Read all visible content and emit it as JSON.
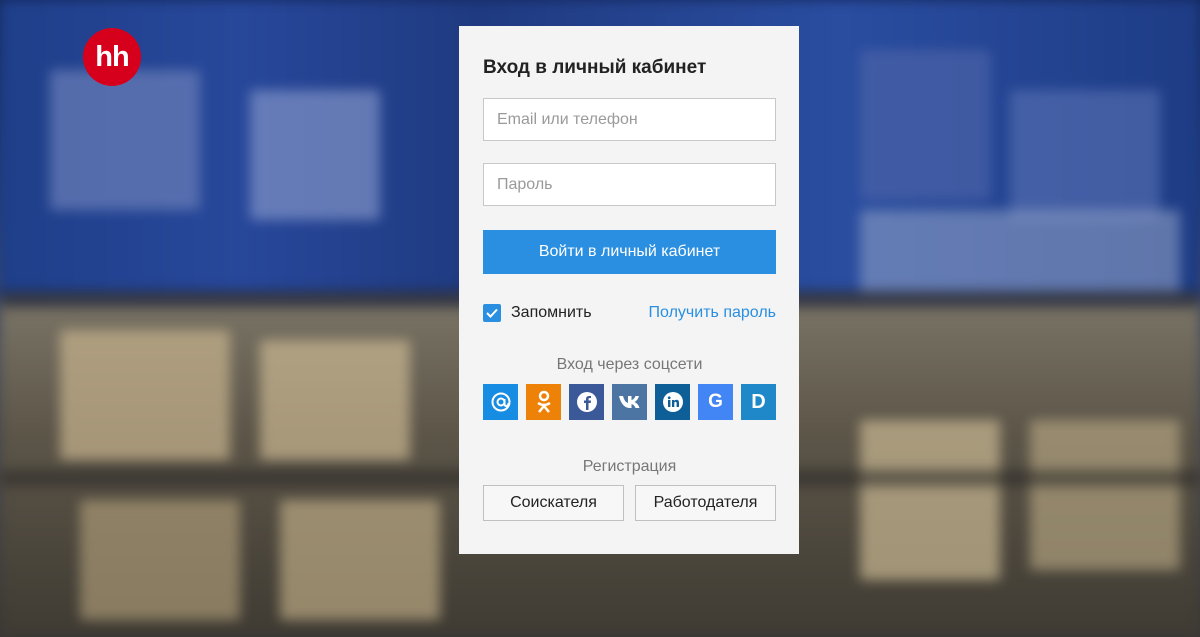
{
  "logo": {
    "text": "hh",
    "color": "#d6001c"
  },
  "login": {
    "title": "Вход в личный кабинет",
    "email_placeholder": "Email или телефон",
    "password_placeholder": "Пароль",
    "submit_label": "Войти в личный кабинет",
    "remember_label": "Запомнить",
    "remember_checked": true,
    "forgot_label": "Получить пароль"
  },
  "social": {
    "title": "Вход через соцсети",
    "networks": [
      {
        "name": "mail-icon",
        "glyph": "@",
        "color": "#168de2"
      },
      {
        "name": "odnoklassniki-icon",
        "glyph": "ok",
        "color": "#ee8208"
      },
      {
        "name": "facebook-icon",
        "glyph": "f",
        "color": "#3b5998"
      },
      {
        "name": "vk-icon",
        "glyph": "vk",
        "color": "#4c75a3"
      },
      {
        "name": "linkedin-icon",
        "glyph": "in",
        "color": "#0e5f97"
      },
      {
        "name": "google-icon",
        "glyph": "G",
        "color": "#4285f4"
      },
      {
        "name": "d-icon",
        "glyph": "D",
        "color": "#1e88c8"
      }
    ]
  },
  "registration": {
    "title": "Регистрация",
    "applicant_label": "Соискателя",
    "employer_label": "Работодателя"
  },
  "colors": {
    "accent": "#2a8fe0",
    "panel": "#f4f4f4"
  }
}
